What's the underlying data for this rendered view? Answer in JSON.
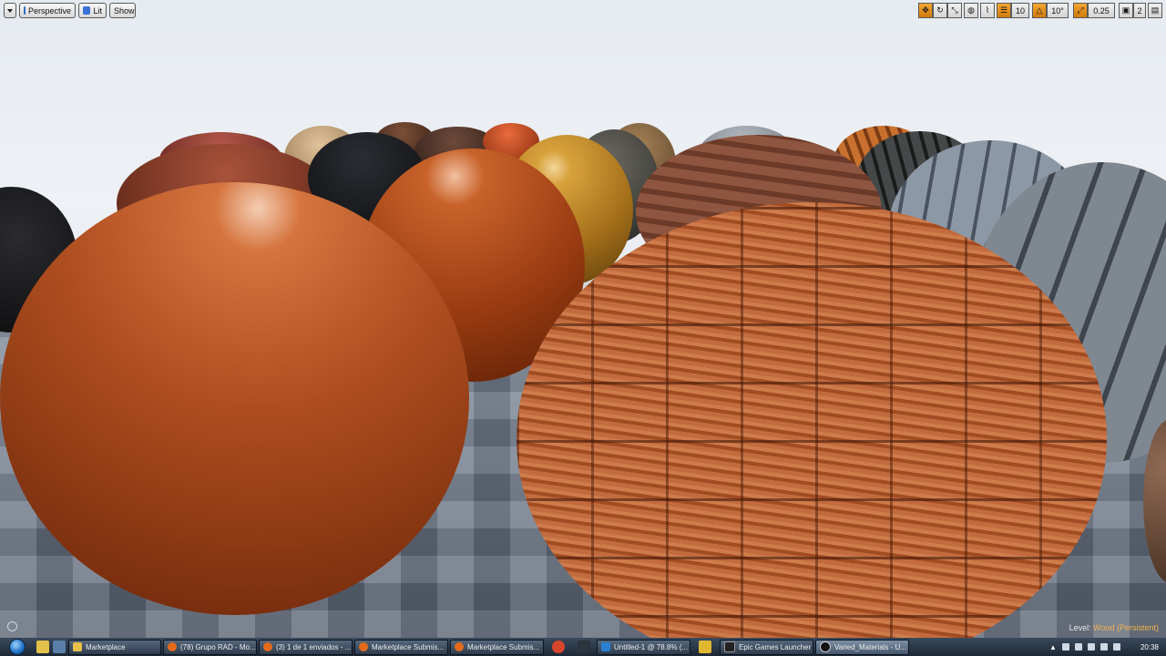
{
  "viewport_toolbar": {
    "menu_label": "",
    "perspective_label": "Perspective",
    "lit_label": "Lit",
    "show_label": "Show",
    "grid_snap_value": "10",
    "rotation_snap_value": "10°",
    "scale_snap_value": "0.25",
    "camera_speed_value": "2"
  },
  "level_info": {
    "prefix": "Level:",
    "name": "Wood (Persistent)"
  },
  "taskbar": {
    "items": [
      {
        "label": "Marketplace",
        "icon": "folder-icon",
        "color": "#e8c04a"
      },
      {
        "label": "(78) Grupo RAD - Mo...",
        "icon": "firefox-icon",
        "color": "#e46a1b"
      },
      {
        "label": "(3) 1 de 1 enviados - ...",
        "icon": "firefox-icon",
        "color": "#e46a1b"
      },
      {
        "label": "Marketplace Submis...",
        "icon": "firefox-icon",
        "color": "#e46a1b"
      },
      {
        "label": "Marketplace Submis...",
        "icon": "firefox-icon",
        "color": "#e46a1b"
      },
      {
        "label": "Untitled-1 @ 78.8% (...",
        "icon": "photoshop-icon",
        "color": "#2b7fd1"
      },
      {
        "label": "Epic Games Launcher",
        "icon": "epic-icon",
        "color": "#222222"
      },
      {
        "label": "Varied_Materials - U...",
        "icon": "unreal-icon",
        "color": "#111111"
      }
    ],
    "clock": "20:38"
  },
  "colors": {
    "accent_orange": "#f3a733"
  }
}
